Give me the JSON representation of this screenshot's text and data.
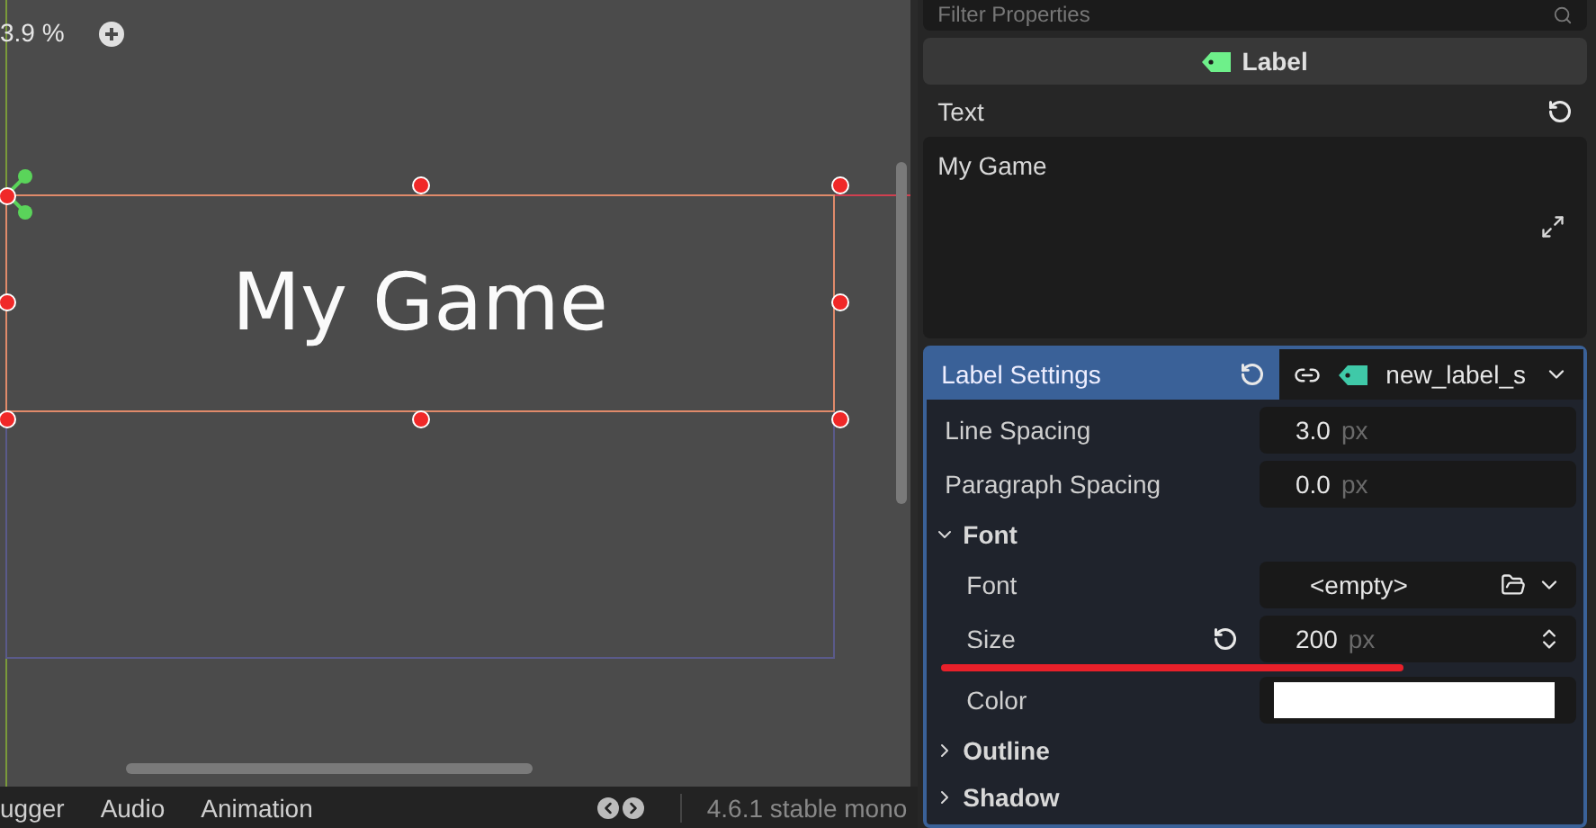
{
  "viewport": {
    "zoom": "3.9 %",
    "label_text": "My Game"
  },
  "inspector": {
    "filter": {
      "placeholder": "Filter Properties"
    },
    "node_type": "Label",
    "text_property": {
      "label": "Text",
      "value": "My Game",
      "modified": true
    },
    "label_settings": {
      "label": "Label Settings",
      "resource": "new_label_s",
      "expanded": true,
      "properties": [
        {
          "kind": "number",
          "label": "Line Spacing",
          "value": "3.0",
          "unit": "px",
          "modified": false
        },
        {
          "kind": "number",
          "label": "Paragraph Spacing",
          "value": "0.0",
          "unit": "px",
          "modified": false
        }
      ],
      "groups": [
        {
          "label": "Font",
          "expanded": true,
          "properties": [
            {
              "kind": "resource",
              "label": "Font",
              "value": "<empty>",
              "modified": false
            },
            {
              "kind": "number",
              "label": "Size",
              "value": "200",
              "unit": "px",
              "modified": true
            },
            {
              "kind": "color",
              "label": "Color",
              "color": "#ffffff",
              "modified": false
            }
          ]
        },
        {
          "label": "Outline",
          "expanded": false
        },
        {
          "label": "Shadow",
          "expanded": false
        }
      ]
    }
  },
  "bottom_panel": {
    "tabs": [
      "ugger",
      "Audio",
      "Animation"
    ],
    "version": "4.6.1 stable mono"
  }
}
